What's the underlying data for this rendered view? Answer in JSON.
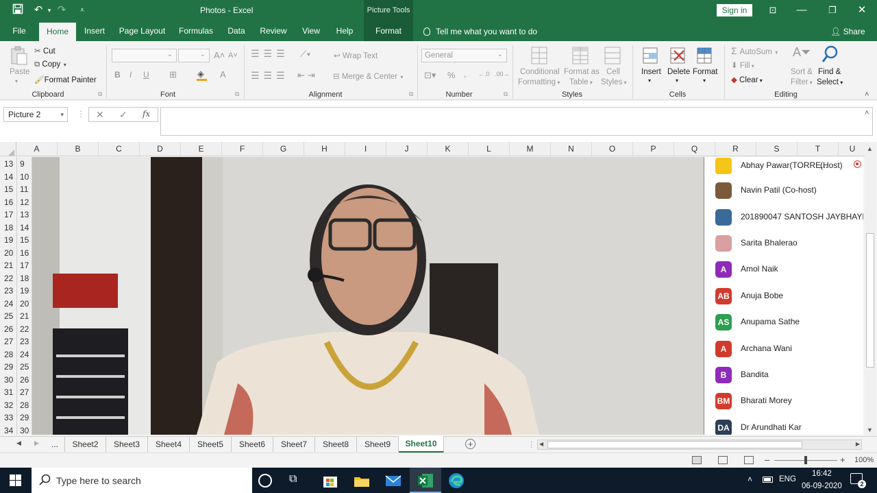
{
  "title_bar": {
    "title": "Photos - Excel",
    "picture_tools": "Picture Tools",
    "sign_in": "Sign in"
  },
  "tabs": [
    {
      "label": "File"
    },
    {
      "label": "Home"
    },
    {
      "label": "Insert"
    },
    {
      "label": "Page Layout"
    },
    {
      "label": "Formulas"
    },
    {
      "label": "Data"
    },
    {
      "label": "Review"
    },
    {
      "label": "View"
    },
    {
      "label": "Help"
    },
    {
      "label": "Format"
    }
  ],
  "tell_me": "Tell me what you want to do",
  "share": "Share",
  "ribbon": {
    "clipboard": {
      "paste": "Paste",
      "cut": "Cut",
      "copy": "Copy",
      "format_painter": "Format Painter",
      "label": "Clipboard"
    },
    "font": {
      "bold": "B",
      "italic": "I",
      "underline": "U",
      "grow": "A",
      "label": "Font"
    },
    "alignment": {
      "wrap_text": "Wrap Text",
      "merge_center": "Merge & Center",
      "label": "Alignment"
    },
    "number": {
      "format": "General",
      "percent": "%",
      "comma": ",",
      "label": "Number"
    },
    "styles": {
      "conditional_1": "Conditional",
      "conditional_2": "Formatting",
      "format_table_1": "Format as",
      "format_table_2": "Table",
      "cell_styles_1": "Cell",
      "cell_styles_2": "Styles",
      "label": "Styles"
    },
    "cells": {
      "insert": "Insert",
      "delete": "Delete",
      "format": "Format",
      "label": "Cells"
    },
    "editing": {
      "autosum": "AutoSum",
      "fill": "Fill",
      "clear": "Clear",
      "sort_1": "Sort &",
      "sort_2": "Filter",
      "find_1": "Find &",
      "find_2": "Select",
      "label": "Editing"
    }
  },
  "formula_bar": {
    "name_box": "Picture 2",
    "fx": "fx"
  },
  "columns": [
    "A",
    "B",
    "C",
    "D",
    "E",
    "F",
    "G",
    "H",
    "I",
    "J",
    "K",
    "L",
    "M",
    "N",
    "O",
    "P",
    "Q",
    "R",
    "S",
    "T",
    "U"
  ],
  "rows": [
    {
      "outer": "13",
      "inner": "9"
    },
    {
      "outer": "14",
      "inner": "10"
    },
    {
      "outer": "15",
      "inner": "11"
    },
    {
      "outer": "16",
      "inner": "12"
    },
    {
      "outer": "17",
      "inner": "13"
    },
    {
      "outer": "18",
      "inner": "14"
    },
    {
      "outer": "19",
      "inner": "15"
    },
    {
      "outer": "20",
      "inner": "16"
    },
    {
      "outer": "21",
      "inner": "17"
    },
    {
      "outer": "22",
      "inner": "18"
    },
    {
      "outer": "23",
      "inner": "19"
    },
    {
      "outer": "24",
      "inner": "20"
    },
    {
      "outer": "25",
      "inner": "21"
    },
    {
      "outer": "26",
      "inner": "22"
    },
    {
      "outer": "27",
      "inner": "23"
    },
    {
      "outer": "28",
      "inner": "24"
    },
    {
      "outer": "29",
      "inner": "25"
    },
    {
      "outer": "30",
      "inner": "26"
    },
    {
      "outer": "31",
      "inner": "27"
    },
    {
      "outer": "32",
      "inner": "28"
    },
    {
      "outer": "33",
      "inner": "29"
    },
    {
      "outer": "34",
      "inner": "30"
    }
  ],
  "participants": [
    {
      "name": "Abhay Pawar(TORRE...",
      "role": "(Host)",
      "initials": "",
      "color": "#f5c518"
    },
    {
      "name": "Navin Patil (Co-host)",
      "initials": "",
      "color": "#7a5a3a"
    },
    {
      "name": "201890047 SANTOSH JAYBHAYE",
      "initials": "",
      "color": "#3a6a9a"
    },
    {
      "name": "Sarita Bhalerao",
      "initials": "",
      "color": "#d8a0a0"
    },
    {
      "name": "Amol Naik",
      "initials": "A",
      "color": "#8e2bb8"
    },
    {
      "name": "Anuja Bobe",
      "initials": "AB",
      "color": "#d13b2e"
    },
    {
      "name": "Anupama Sathe",
      "initials": "AS",
      "color": "#2e9e4f"
    },
    {
      "name": "Archana Wani",
      "initials": "A",
      "color": "#d13b2e"
    },
    {
      "name": "Bandita",
      "initials": "B",
      "color": "#8e2bb8"
    },
    {
      "name": "Bharati Morey",
      "initials": "BM",
      "color": "#d13b2e"
    },
    {
      "name": "Dr Arundhati Kar",
      "initials": "DA",
      "color": "#2b3f55"
    }
  ],
  "sheets": [
    "...",
    "Sheet2",
    "Sheet3",
    "Sheet4",
    "Sheet5",
    "Sheet6",
    "Sheet7",
    "Sheet8",
    "Sheet9",
    "Sheet10"
  ],
  "status": {
    "zoom": "100%",
    "minus": "–",
    "plus": "+"
  },
  "taskbar": {
    "search_placeholder": "Type here to search",
    "lang": "ENG",
    "time": "16:42",
    "date": "06-09-2020",
    "notif_count": "2"
  },
  "colors": {
    "excel_green": "#217346",
    "excel_dark": "#1a5c38",
    "taskbar": "#0d1b2a"
  }
}
